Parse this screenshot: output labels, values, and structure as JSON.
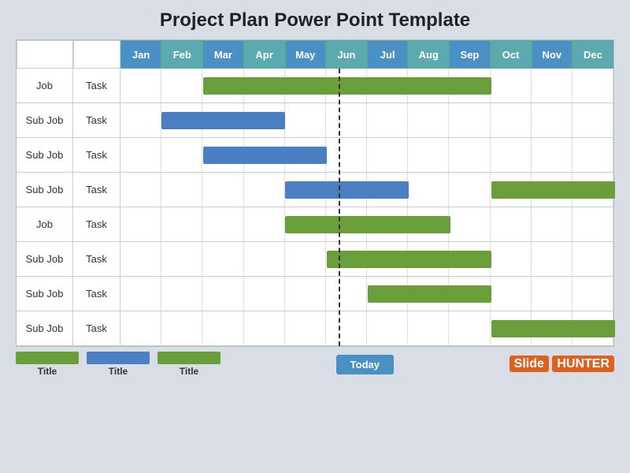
{
  "title": "Project Plan Power Point Template",
  "months": [
    "Jan",
    "Feb",
    "Mar",
    "Apr",
    "May",
    "Jun",
    "Jul",
    "Aug",
    "Sep",
    "Oct",
    "Nov",
    "Dec"
  ],
  "rows": [
    {
      "job": "Job",
      "task": "Task",
      "bars": [
        {
          "color": "green",
          "start": 2,
          "end": 9
        }
      ]
    },
    {
      "job": "Sub Job",
      "task": "Task",
      "bars": [
        {
          "color": "blue",
          "start": 1,
          "end": 4
        }
      ]
    },
    {
      "job": "Sub Job",
      "task": "Task",
      "bars": [
        {
          "color": "blue",
          "start": 2,
          "end": 5
        }
      ]
    },
    {
      "job": "Sub Job",
      "task": "Task",
      "bars": [
        {
          "color": "blue",
          "start": 4,
          "end": 7
        },
        {
          "color": "green",
          "start": 9,
          "end": 12
        }
      ]
    },
    {
      "job": "Job",
      "task": "Task",
      "bars": [
        {
          "color": "green",
          "start": 4,
          "end": 8
        }
      ]
    },
    {
      "job": "Sub Job",
      "task": "Task",
      "bars": [
        {
          "color": "green",
          "start": 5,
          "end": 9
        }
      ]
    },
    {
      "job": "Sub Job",
      "task": "Task",
      "bars": [
        {
          "color": "green",
          "start": 6,
          "end": 9
        }
      ]
    },
    {
      "job": "Sub Job",
      "task": "Task",
      "bars": [
        {
          "color": "green",
          "start": 9,
          "end": 12
        }
      ]
    }
  ],
  "today_col": 5.3,
  "today_label": "Today",
  "legend": [
    {
      "color": "#6a9e3a",
      "label": "Title"
    },
    {
      "color": "#4a7fc1",
      "label": "Title"
    },
    {
      "color": "#6a9e3a",
      "label": "Title"
    }
  ],
  "brand_text": "Slide",
  "brand_highlight": "HUNTER",
  "colors": {
    "month_blue": "#4a90c4",
    "month_teal": "#5baab0",
    "bar_green": "#6a9e3a",
    "bar_blue": "#4a7fc1"
  }
}
